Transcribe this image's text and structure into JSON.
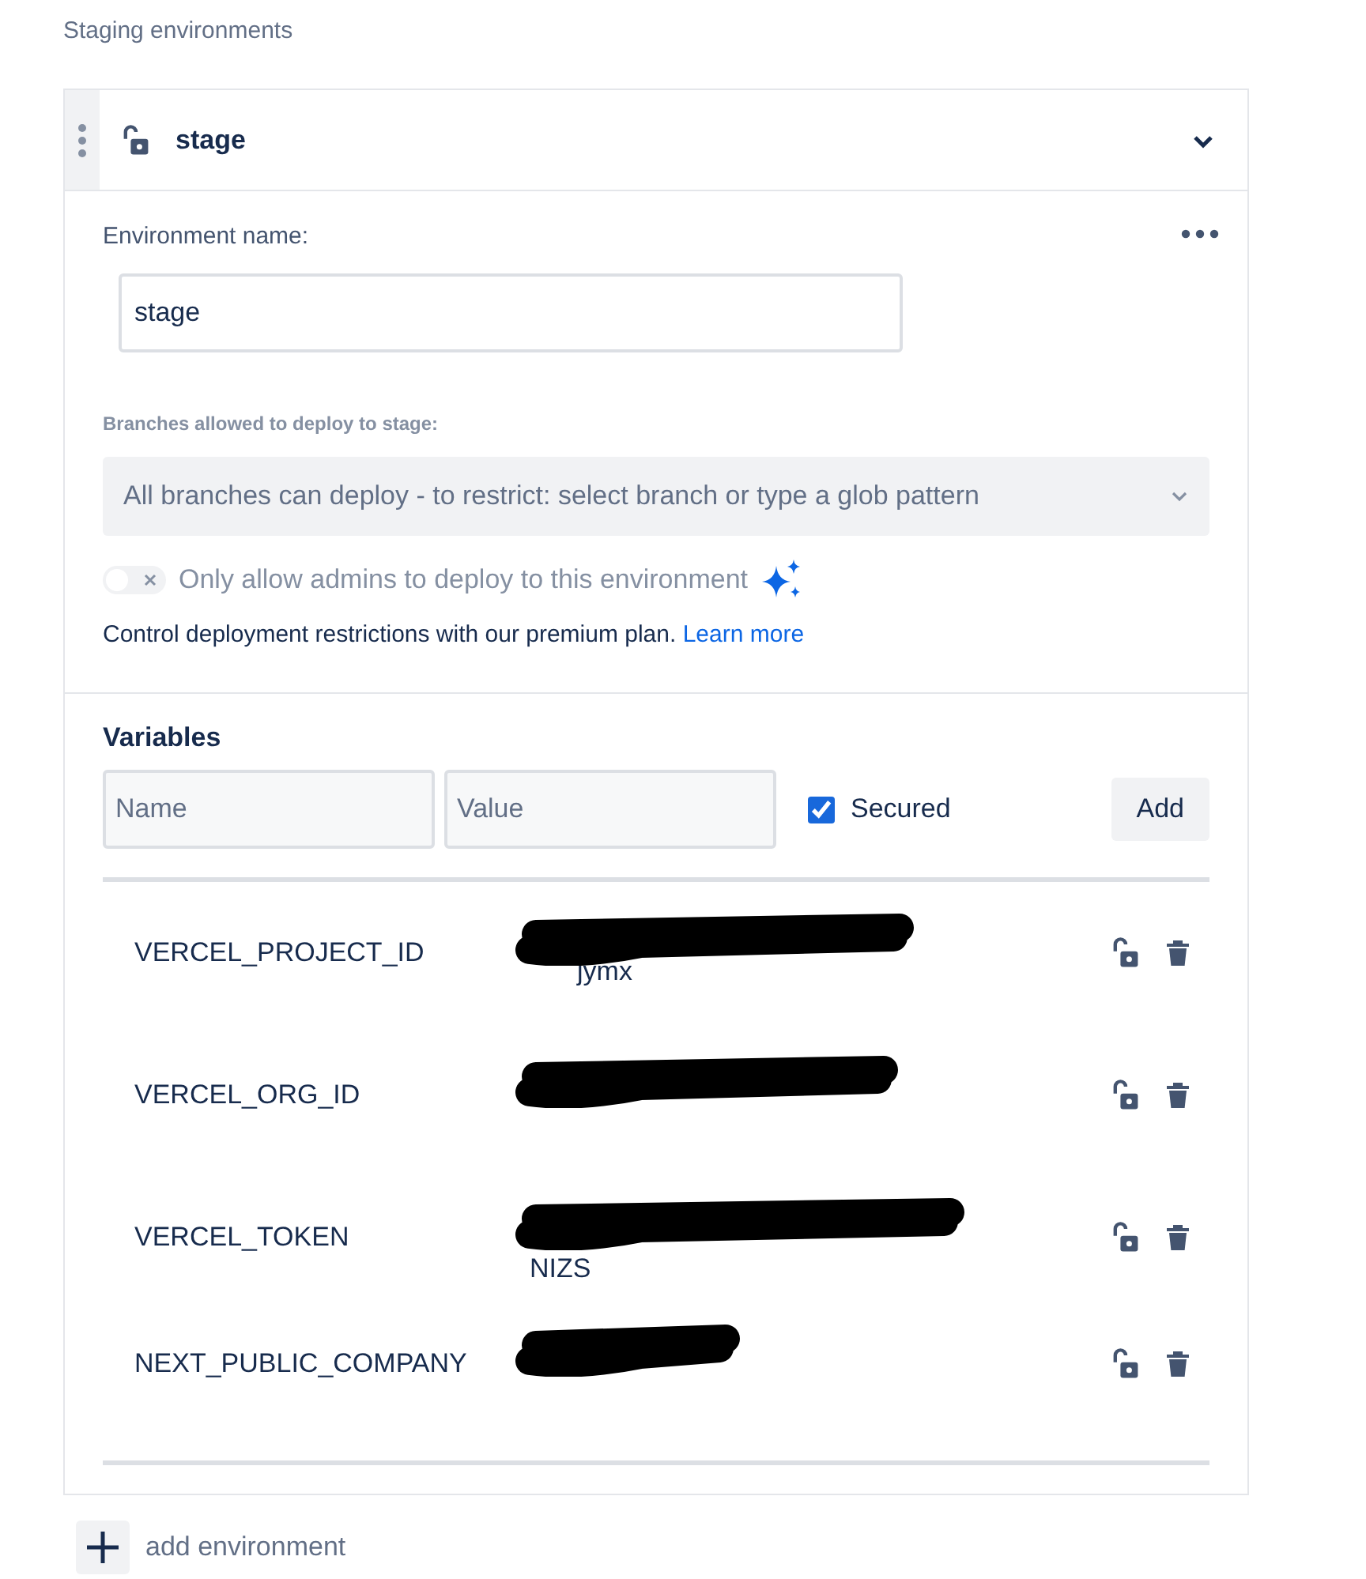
{
  "section_title": "Staging environments",
  "environment": {
    "name": "stage",
    "expanded": true,
    "name_label": "Environment name:",
    "name_value": "stage",
    "branches_label": "Branches allowed to deploy to stage:",
    "branches_placeholder": "All branches can deploy - to restrict: select branch or type a glob pattern",
    "admins_toggle": {
      "label": "Only allow admins to deploy to this environment",
      "on": false
    },
    "premium_note": "Control deployment restrictions with our premium plan.",
    "premium_link": "Learn more",
    "variables_title": "Variables",
    "new_variable": {
      "name_placeholder": "Name",
      "value_placeholder": "Value",
      "secured_label": "Secured",
      "secured": true,
      "add_button": "Add"
    },
    "variables": [
      {
        "name": "VERCEL_PROJECT_ID",
        "visible_value": "jymx"
      },
      {
        "name": "VERCEL_ORG_ID"
      },
      {
        "name": "VERCEL_TOKEN",
        "visible_value": "NIZS"
      },
      {
        "name": "NEXT_PUBLIC_COMPANY"
      }
    ]
  },
  "add_environment": "add environment"
}
